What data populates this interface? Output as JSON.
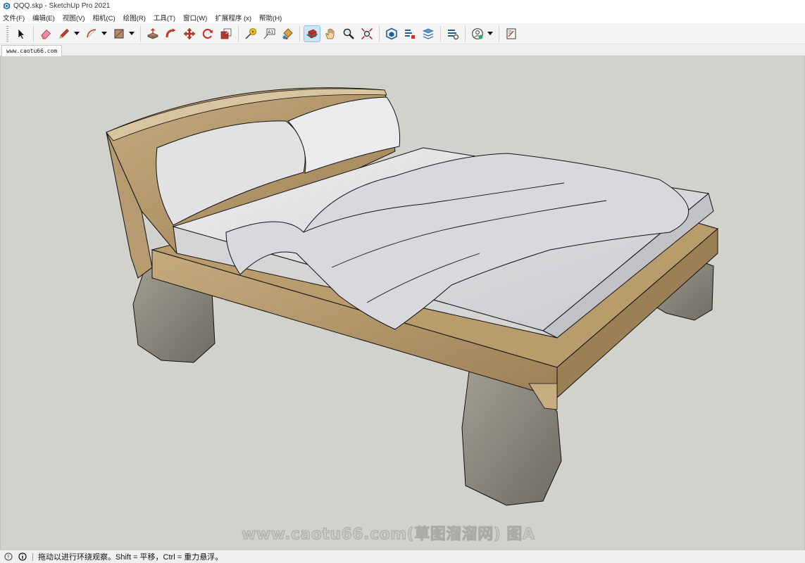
{
  "window": {
    "title": "QQQ.skp - SketchUp Pro 2021"
  },
  "menu": [
    "文件(F)",
    "编辑(E)",
    "视图(V)",
    "相机(C)",
    "绘图(R)",
    "工具(T)",
    "窗口(W)",
    "扩展程序 (x)",
    "帮助(H)"
  ],
  "toolbar": {
    "tools": [
      {
        "name": "select-tool",
        "icon": "arrow-cursor-icon"
      },
      {
        "name": "eraser-tool",
        "icon": "eraser-icon"
      },
      {
        "name": "line-tool",
        "icon": "pencil-icon"
      },
      {
        "name": "arc-tool",
        "icon": "arc-icon"
      },
      {
        "name": "rectangle-tool",
        "icon": "rectangle-icon"
      },
      {
        "name": "push-pull-tool",
        "icon": "push-pull-icon"
      },
      {
        "name": "follow-me-tool",
        "icon": "follow-me-icon"
      },
      {
        "name": "move-tool",
        "icon": "move-icon"
      },
      {
        "name": "rotate-tool",
        "icon": "rotate-icon"
      },
      {
        "name": "scale-tool",
        "icon": "scale-icon"
      },
      {
        "name": "tape-measure-tool",
        "icon": "tape-measure-icon"
      },
      {
        "name": "text-tool",
        "icon": "text-icon"
      },
      {
        "name": "paint-bucket-tool",
        "icon": "paint-bucket-icon"
      },
      {
        "name": "orbit-tool",
        "icon": "orbit-icon"
      },
      {
        "name": "pan-tool",
        "icon": "hand-icon"
      },
      {
        "name": "zoom-tool",
        "icon": "magnifier-icon"
      },
      {
        "name": "zoom-extents-tool",
        "icon": "zoom-extents-icon"
      },
      {
        "name": "warehouse-tool",
        "icon": "3d-warehouse-icon"
      },
      {
        "name": "extension-warehouse-tool",
        "icon": "extension-warehouse-icon"
      },
      {
        "name": "layout-tool",
        "icon": "layout-icon"
      },
      {
        "name": "extension-manager-tool",
        "icon": "extension-manager-icon"
      },
      {
        "name": "account-tool",
        "icon": "account-icon"
      },
      {
        "name": "send-to-layout-tool",
        "icon": "send-to-layout-icon"
      }
    ],
    "active_tool": "orbit-tool"
  },
  "scene_tab": {
    "label": "www.caotu66.com"
  },
  "watermark": {
    "text": "www.caotu66.com(草图溜溜网) 图A"
  },
  "status": {
    "message": "拖动以进行环绕观察。Shift = 平移，Ctrl = 重力悬浮。"
  },
  "colors": {
    "viewport_bg": "#d2d2cd",
    "toolbar_bg": "#f4f4f4",
    "active_tool_bg": "#cfe3f7",
    "wood": "#b39a70",
    "stone": "#8e8b80",
    "linen": "#e4e4e6"
  }
}
